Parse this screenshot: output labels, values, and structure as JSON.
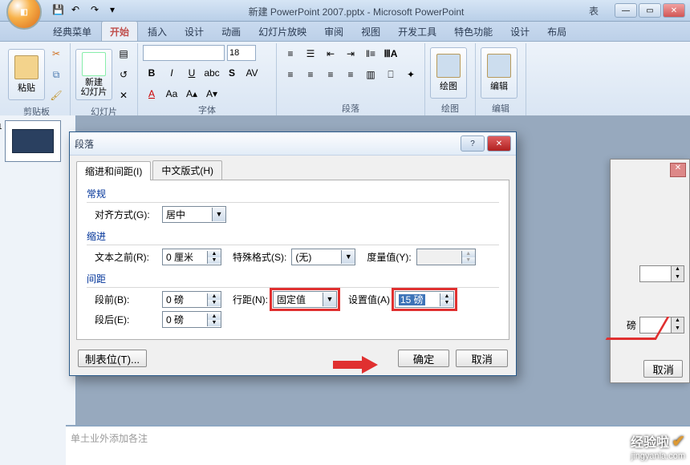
{
  "titlebar": {
    "title": "新建 PowerPoint 2007.pptx - Microsoft PowerPoint",
    "extra": "表"
  },
  "tabs": [
    "经典菜单",
    "开始",
    "插入",
    "设计",
    "动画",
    "幻灯片放映",
    "审阅",
    "视图",
    "开发工具",
    "特色功能",
    "设计",
    "布局"
  ],
  "active_tab": 1,
  "ribbon": {
    "clipboard": {
      "label": "剪贴板",
      "paste": "粘贴"
    },
    "slides": {
      "label": "幻灯片",
      "new": "新建\n幻灯片"
    },
    "font": {
      "label": "字体",
      "size": "18"
    },
    "paragraph": {
      "label": "段落"
    },
    "drawing": {
      "label": "绘图"
    },
    "editing": {
      "label": "编辑"
    }
  },
  "dialog": {
    "title": "段落",
    "tabs": [
      "缩进和间距(I)",
      "中文版式(H)"
    ],
    "active_tab": 0,
    "general": {
      "title": "常规",
      "align_label": "对齐方式(G):",
      "align_value": "居中"
    },
    "indent": {
      "title": "缩进",
      "before_label": "文本之前(R):",
      "before_value": "0 厘米",
      "special_label": "特殊格式(S):",
      "special_value": "(无)",
      "metric_label": "度量值(Y):"
    },
    "spacing": {
      "title": "间距",
      "before_label": "段前(B):",
      "before_value": "0 磅",
      "after_label": "段后(E):",
      "after_value": "0 磅",
      "line_label": "行距(N):",
      "line_value": "固定值",
      "setvalue_label": "设置值(A)",
      "setvalue_value": "15 磅"
    },
    "buttons": {
      "tabstops": "制表位(T)...",
      "ok": "确定",
      "cancel": "取消"
    }
  },
  "side": {
    "unit": "磅",
    "cancel": "取消"
  },
  "notes": "单土业外添加各注",
  "watermark": {
    "line1": "经验啦",
    "line2": "jingyanla.com"
  }
}
